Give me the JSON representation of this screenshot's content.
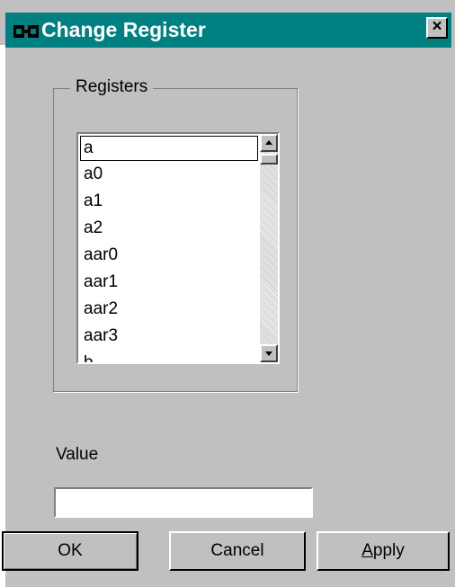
{
  "window": {
    "title": "Change Register",
    "icon": "register-app-icon",
    "close_label": "×"
  },
  "registers": {
    "group_label": "Registers",
    "selected": "a",
    "items": [
      "a",
      "a0",
      "a1",
      "a2",
      "aar0",
      "aar1",
      "aar2",
      "aar3",
      "b"
    ]
  },
  "value": {
    "label": "Value",
    "current": ""
  },
  "buttons": {
    "ok": "OK",
    "cancel": "Cancel",
    "apply_mnemonic": "A",
    "apply_rest": "pply"
  },
  "colors": {
    "titlebar": "#008080",
    "face": "#c0c0c0"
  }
}
